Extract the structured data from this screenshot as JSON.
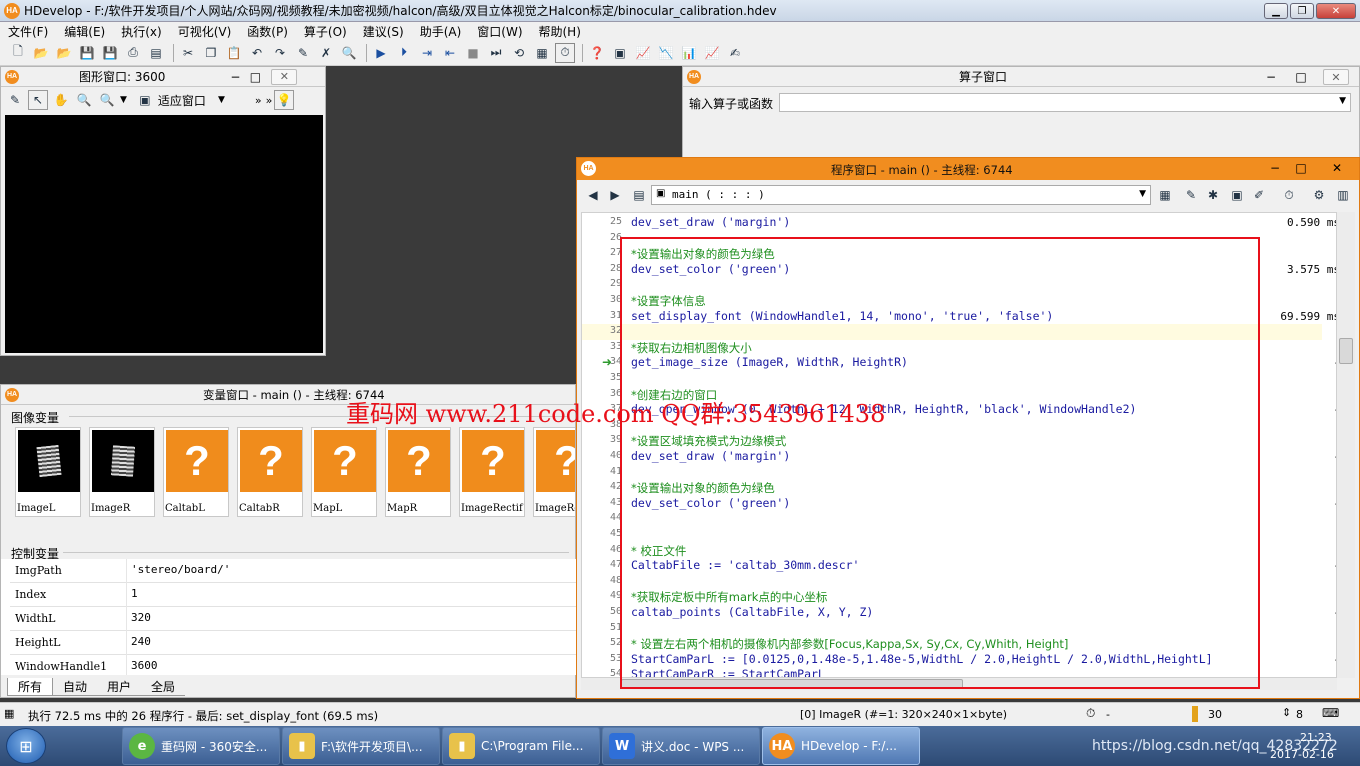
{
  "app": {
    "title": "HDevelop - F:/软件开发项目/个人网站/众码网/视频教程/未加密视频/halcon/高级/双目立体视觉之Halcon标定/binocular_calibration.hdev",
    "logo": "HA",
    "window_buttons": {
      "minimize": "▁",
      "maximize": "❐",
      "close": "✕"
    }
  },
  "menu": [
    "文件(F)",
    "编辑(E)",
    "执行(x)",
    "可视化(V)",
    "函数(P)",
    "算子(O)",
    "建议(S)",
    "助手(A)",
    "窗口(W)",
    "帮助(H)"
  ],
  "graphics_window": {
    "title": "图形窗口: 3600",
    "fit_window": "适应窗口",
    "btn_min": "−",
    "btn_max": "□",
    "btn_close": "✕"
  },
  "operator_window": {
    "title": "算子窗口",
    "input_label": "输入算子或函数",
    "input_value": ""
  },
  "variable_window": {
    "title": "变量窗口 - main () - 主线程: 6744",
    "iconic_label": "图像变量",
    "iconic_vars": [
      {
        "name": "ImageL",
        "kind": "image"
      },
      {
        "name": "ImageR",
        "kind": "image"
      },
      {
        "name": "CaltabL",
        "kind": "unknown"
      },
      {
        "name": "CaltabR",
        "kind": "unknown"
      },
      {
        "name": "MapL",
        "kind": "unknown"
      },
      {
        "name": "MapR",
        "kind": "unknown"
      },
      {
        "name": "ImageRectif",
        "kind": "unknown"
      },
      {
        "name": "ImageRe",
        "kind": "unknown"
      }
    ],
    "question_mark": "?",
    "control_label": "控制变量",
    "control_vars": [
      {
        "name": "ImgPath",
        "value": "'stereo/board/'"
      },
      {
        "name": "Index",
        "value": "1"
      },
      {
        "name": "WidthL",
        "value": "320"
      },
      {
        "name": "HeightL",
        "value": "240"
      },
      {
        "name": "WindowHandle1",
        "value": "3600"
      }
    ],
    "tabs": [
      "所有",
      "自动",
      "用户",
      "全局"
    ]
  },
  "program_window": {
    "title": "程序窗口 - main () - 主线程: 6744",
    "procedure": "main ( : : : )",
    "lines": [
      {
        "num": "25",
        "text": "dev_set_draw ('margin')",
        "type": "op",
        "time": "0.590 ms"
      },
      {
        "num": "26",
        "text": "",
        "type": "op",
        "time": ""
      },
      {
        "num": "27",
        "text": "*设置输出对象的颜色为绿色",
        "type": "cm",
        "time": ""
      },
      {
        "num": "28",
        "text": "dev_set_color ('green')",
        "type": "op",
        "time": "3.575 ms"
      },
      {
        "num": "29",
        "text": "",
        "type": "op",
        "time": ""
      },
      {
        "num": "30",
        "text": "*设置字体信息",
        "type": "cm",
        "time": ""
      },
      {
        "num": "31",
        "text": "set_display_font (WindowHandle1, 14, 'mono', 'true', 'false')",
        "type": "op",
        "time": "69.599 ms"
      },
      {
        "num": "32",
        "text": "",
        "type": "op",
        "time": ""
      },
      {
        "num": "33",
        "text": "*获取右边相机图像大小",
        "type": "cm",
        "time": ""
      },
      {
        "num": "34",
        "text": "get_image_size (ImageR, WidthR, HeightR)",
        "type": "op",
        "time": "-"
      },
      {
        "num": "35",
        "text": "",
        "type": "op",
        "time": ""
      },
      {
        "num": "36",
        "text": "*创建右边的窗口",
        "type": "cm",
        "time": ""
      },
      {
        "num": "37",
        "text": "dev_open_window (0, WidthL + 12, WidthR, HeightR, 'black', WindowHandle2)",
        "type": "op",
        "time": "-"
      },
      {
        "num": "38",
        "text": "",
        "type": "op",
        "time": ""
      },
      {
        "num": "39",
        "text": "*设置区域填充模式为边缘模式",
        "type": "cm",
        "time": ""
      },
      {
        "num": "40",
        "text": "dev_set_draw ('margin')",
        "type": "op",
        "time": "-"
      },
      {
        "num": "41",
        "text": "",
        "type": "op",
        "time": ""
      },
      {
        "num": "42",
        "text": "*设置输出对象的颜色为绿色",
        "type": "cm",
        "time": ""
      },
      {
        "num": "43",
        "text": "dev_set_color ('green')",
        "type": "op",
        "time": "-"
      },
      {
        "num": "44",
        "text": "",
        "type": "op",
        "time": ""
      },
      {
        "num": "45",
        "text": "",
        "type": "op",
        "time": ""
      },
      {
        "num": "46",
        "text": "* 校正文件",
        "type": "cm",
        "time": ""
      },
      {
        "num": "47",
        "text": "CaltabFile := 'caltab_30mm.descr'",
        "type": "op",
        "time": "-"
      },
      {
        "num": "48",
        "text": "",
        "type": "op",
        "time": ""
      },
      {
        "num": "49",
        "text": "*获取标定板中所有mark点的中心坐标",
        "type": "cm",
        "time": ""
      },
      {
        "num": "50",
        "text": "caltab_points (CaltabFile, X, Y, Z)",
        "type": "op",
        "time": "-"
      },
      {
        "num": "51",
        "text": "",
        "type": "op",
        "time": ""
      },
      {
        "num": "52",
        "text": "* 设置左右两个相机的摄像机内部参数[Focus,Kappa,Sx, Sy,Cx, Cy,Whith, Height]",
        "type": "cm",
        "time": ""
      },
      {
        "num": "53",
        "text": "StartCamParL := [0.0125,0,1.48e-5,1.48e-5,WidthL / 2.0,HeightL / 2.0,WidthL,HeightL]",
        "type": "op",
        "time": "-"
      },
      {
        "num": "54",
        "text": "StartCamParR := StartCamParL",
        "type": "op",
        "time": ""
      }
    ]
  },
  "watermark": "重码网 www.211code.com   QQ群:3543961438",
  "statusbar": {
    "exec": "执行 72.5 ms 中的 26 程序行 - 最后: set_display_font (69.5 ms)",
    "image_info": "[0] ImageR (#=1: 320×240×1×byte)",
    "timer": "-",
    "zoom": "30",
    "extra": "8"
  },
  "taskbar": {
    "items": [
      "重码网 - 360安全...",
      "F:\\软件开发项目\\...",
      "C:\\Program File...",
      "讲义.doc - WPS ...",
      "HDevelop - F:/..."
    ],
    "clock_time": "21:23",
    "clock_date": "2017-02-16",
    "url_watermark": "https://blog.csdn.net/qq_42832272"
  },
  "colors": {
    "accent": "#f18d1f",
    "highlight_box": "#e8101a",
    "comment": "#1f8f1f",
    "operator": "#1a1aa0"
  }
}
